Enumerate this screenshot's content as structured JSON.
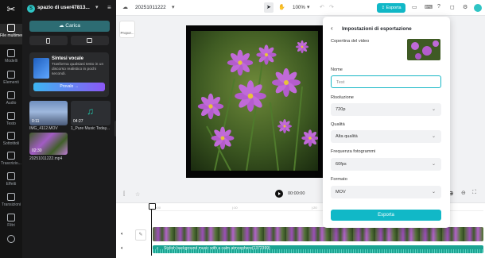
{
  "workspace": {
    "name": "spazio di user47813...",
    "avatar_letter": "S"
  },
  "rail": {
    "items": [
      {
        "label": "File multimed..."
      },
      {
        "label": "Modelli"
      },
      {
        "label": "Elementi"
      },
      {
        "label": "Audio"
      },
      {
        "label": "Testo"
      },
      {
        "label": "Sottotitoli"
      },
      {
        "label": "Trascrizio..."
      },
      {
        "label": "Effetti"
      },
      {
        "label": "Transizioni"
      },
      {
        "label": "Filtri"
      }
    ]
  },
  "panel": {
    "upload_label": "Carica",
    "promo": {
      "title": "Sintesi vocale",
      "text": "Trasforma qualsiasi testo in un discorso realistico in pochi secondi.",
      "button": "Provalo →"
    },
    "media": [
      {
        "name": "IMG_4112.MOV",
        "duration": "0:11"
      },
      {
        "name": "1_Pure Music Today...",
        "duration": "04:27"
      },
      {
        "name": "20251011222.mp4",
        "duration": "02:30"
      }
    ]
  },
  "topbar": {
    "project_name": "20251011222",
    "zoom": "100%",
    "export_label": "Esporta"
  },
  "editor": {
    "prop_label": "Propor...",
    "timecode": "00:00:00"
  },
  "timeline": {
    "ruler": [
      "00:00",
      "|:10",
      "|:20"
    ],
    "audio_label": "Stylish background music with a calm atmosphere(1372399)"
  },
  "export_dialog": {
    "title": "Impostazioni di esportazione",
    "cover_label": "Copertina del video",
    "name_label": "Nome",
    "name_value": "Test",
    "resolution_label": "Risoluzione",
    "resolution_value": "720p",
    "quality_label": "Qualità",
    "quality_value": "Alta qualità",
    "fps_label": "Frequenza fotogrammi",
    "fps_value": "60fps",
    "format_label": "Formato",
    "format_value": "MOV",
    "export_button": "Esporta"
  },
  "colors": {
    "accent": "#11b8c7",
    "rail_bg": "#141414",
    "panel_bg": "#1b1b1c"
  }
}
